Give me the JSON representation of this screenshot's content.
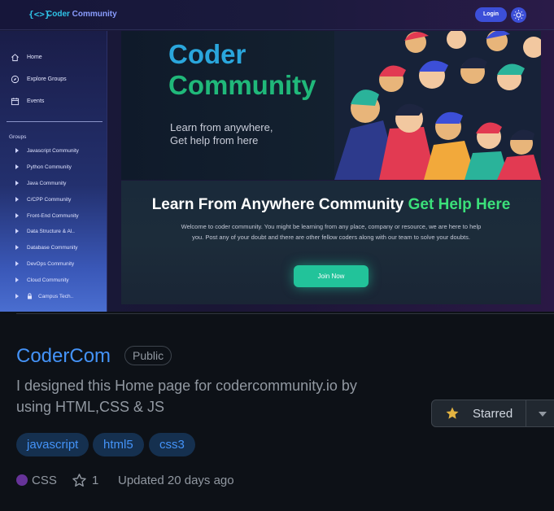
{
  "preview": {
    "brand": {
      "mark": "{<>}",
      "name_part1": "Coder ",
      "name_part2": "Community"
    },
    "login_label": "Login",
    "sidebar": {
      "nav": [
        {
          "label": "Home",
          "icon": "home-icon"
        },
        {
          "label": "Explore Groups",
          "icon": "compass-icon"
        },
        {
          "label": "Events",
          "icon": "calendar-icon"
        }
      ],
      "groups_title": "Groups",
      "groups": [
        "Javascript Community",
        "Python Community",
        "Java Community",
        "C/CPP Community",
        "Front-End Community",
        "Data Structure & Al..",
        "Database Community",
        "DevOps Community",
        "Cloud Community",
        "Campus Tech.."
      ]
    },
    "hero": {
      "title_line1": "Coder",
      "title_line2": "Community",
      "subtitle_line1": "Learn from anywhere,",
      "subtitle_line2": "Get help from here"
    },
    "banner": {
      "title_white": "Learn From Anywhere Community ",
      "title_green": "Get Help Here",
      "text": "Welcome to coder community. You might be learning from any place, company or resource, we are here to help you. Post any of your doubt and there are other fellow coders along with our team to solve your doubts.",
      "join_label": "Join Now"
    }
  },
  "repo": {
    "name": "CoderCom",
    "visibility": "Public",
    "description": "I designed this Home page for codercommunity.io by using HTML,CSS & JS",
    "star_label": "Starred",
    "topics": [
      "javascript",
      "html5",
      "css3"
    ],
    "language": "CSS",
    "language_color": "#663399",
    "stars": "1",
    "updated": "Updated 20 days ago"
  },
  "colors": {
    "link_blue": "#4493f8",
    "star_yellow": "#e3b341",
    "hero_blue": "#2aa6dc",
    "hero_green": "#20b87a",
    "banner_green": "#3be07a",
    "join_button": "#22c39a"
  }
}
